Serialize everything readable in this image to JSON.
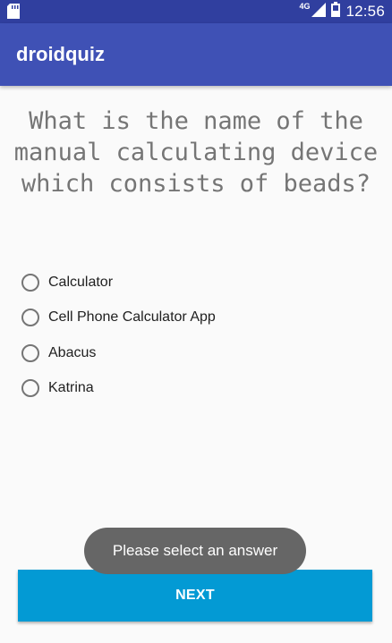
{
  "status_bar": {
    "network_label": "4G",
    "time": "12:56",
    "icons": [
      "sd-card-icon",
      "signal-icon",
      "battery-icon"
    ]
  },
  "app_bar": {
    "title": "droidquiz"
  },
  "question": {
    "text": "What is the name of the manual calculating device which consists of beads?"
  },
  "options": [
    {
      "label": "Calculator",
      "selected": false
    },
    {
      "label": "Cell Phone Calculator App",
      "selected": false
    },
    {
      "label": "Abacus",
      "selected": false
    },
    {
      "label": "Katrina",
      "selected": false
    }
  ],
  "toast": {
    "message": "Please select an answer"
  },
  "next_button": {
    "label": "NEXT"
  },
  "colors": {
    "status_bar": "#303f9f",
    "app_bar": "#3f51b5",
    "next_button": "#039ad4",
    "toast": "#666666"
  }
}
